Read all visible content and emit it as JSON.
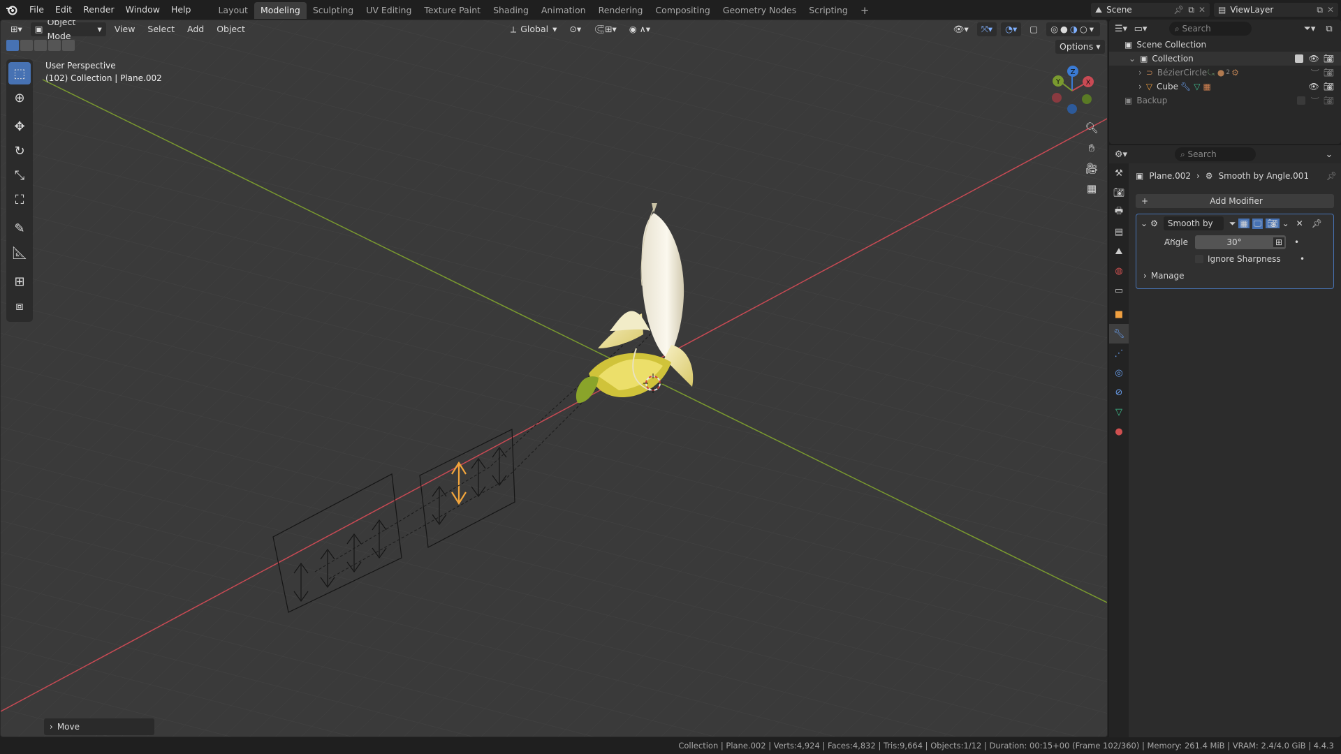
{
  "topbar": {
    "menus": [
      "File",
      "Edit",
      "Render",
      "Window",
      "Help"
    ],
    "workspaces": [
      "Layout",
      "Modeling",
      "Sculpting",
      "UV Editing",
      "Texture Paint",
      "Shading",
      "Animation",
      "Rendering",
      "Compositing",
      "Geometry Nodes",
      "Scripting"
    ],
    "active_workspace": "Modeling",
    "add_tab": "+",
    "scene_label": "Scene",
    "viewlayer_label": "ViewLayer"
  },
  "viewport_header": {
    "mode": "Object Mode",
    "menus": [
      "View",
      "Select",
      "Add",
      "Object"
    ],
    "transform_orientation": "Global",
    "options_label": "Options"
  },
  "viewport": {
    "perspective": "User Perspective",
    "context": "(102) Collection | Plane.002",
    "gizmo": {
      "x": "X",
      "y": "Y",
      "z": "Z"
    },
    "last_op": "Move"
  },
  "outliner": {
    "search_placeholder": "Search",
    "root": "Scene Collection",
    "items": [
      {
        "label": "Collection"
      },
      {
        "label": "BézierCircle",
        "badge": "2"
      },
      {
        "label": "Cube"
      },
      {
        "label": "Backup"
      }
    ]
  },
  "properties": {
    "search_placeholder": "Search",
    "breadcrumb": {
      "object": "Plane.002",
      "modifier": "Smooth by Angle.001"
    },
    "add_modifier": "Add Modifier",
    "modifier": {
      "name": "Smooth by ...",
      "angle_label": "Angle",
      "angle_value": "30°",
      "ignore_sharpness": "Ignore Sharpness",
      "manage": "Manage"
    }
  },
  "statusbar": {
    "text": "Collection | Plane.002 | Verts:4,924 | Faces:4,832 | Tris:9,664 | Objects:1/12 | Duration: 00:15+00 (Frame 102/360) | Memory: 261.4 MiB | VRAM: 2.4/4.0 GiB | 4.4.3"
  },
  "colors": {
    "accent": "#4772b3",
    "x_axis": "#c94a54",
    "y_axis": "#7a9a2f",
    "z_axis": "#3a7bd5",
    "selection": "#f2a53c"
  }
}
